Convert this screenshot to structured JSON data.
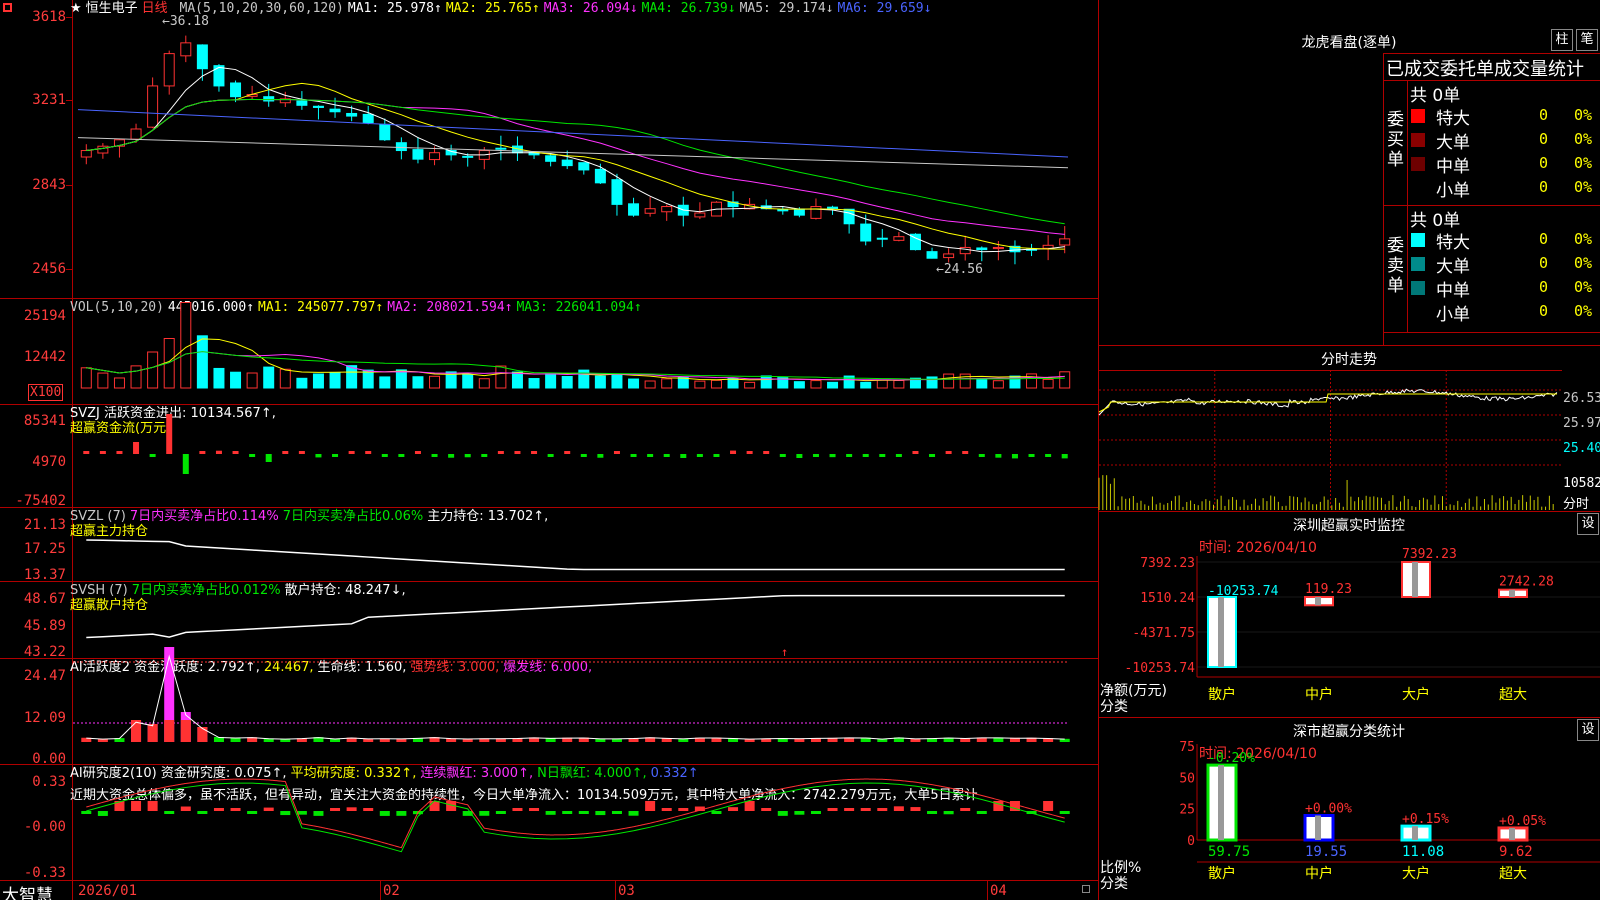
{
  "window": {
    "corner_icon": "menu-square-icon",
    "brand": "大智慧"
  },
  "stock": {
    "star": "★",
    "name": "恒生电子",
    "period": "日线"
  },
  "kline": {
    "y_labels": [
      "3618",
      "3231",
      "2843",
      "2456"
    ],
    "high_label": "36.18",
    "low_label": "24.56",
    "ma_info": [
      {
        "text": "MA(5,10,20,30,60,120)",
        "color": "#c8c8c8"
      },
      {
        "text": "MA1: 25.978↑",
        "color": "#ffffff"
      },
      {
        "text": "MA2: 25.765↑",
        "color": "#ffff00"
      },
      {
        "text": "MA3: 26.094↓",
        "color": "#ff32ff"
      },
      {
        "text": "MA4: 26.739↓",
        "color": "#00e600"
      },
      {
        "text": "MA5: 29.174↓",
        "color": "#c8c8c8"
      },
      {
        "text": "MA6: 29.659↓",
        "color": "#4a64ff"
      }
    ]
  },
  "vol": {
    "y_labels": [
      "25194",
      "12442",
      "X100"
    ],
    "info": [
      {
        "text": "VOL(5,10,20)",
        "color": "#c8c8c8"
      },
      {
        "text": "445016.000↑",
        "color": "#ffffff"
      },
      {
        "text": "MA1: 245077.797↑",
        "color": "#ffff00"
      },
      {
        "text": "MA2: 208021.594↑",
        "color": "#ff32ff"
      },
      {
        "text": "MA3: 226041.094↑",
        "color": "#00e600"
      }
    ]
  },
  "svzj": {
    "y_labels": [
      "85341",
      "4970",
      "-75402"
    ],
    "line1": "SVZJ  活跃资金进出: 10134.567↑,",
    "line2": "超赢资金流(万元)"
  },
  "svzl": {
    "y_labels": [
      "21.13",
      "17.25",
      "13.37"
    ],
    "info": [
      {
        "text": "SVZL (7)",
        "color": "#c8c8c8"
      },
      {
        "text": "7日内买卖净占比0.114%",
        "color": "#ff32ff"
      },
      {
        "text": "7日内买卖净占比0.06%",
        "color": "#00e600"
      },
      {
        "text": "主力持仓: 13.702↑,",
        "color": "#ffffff"
      }
    ],
    "line2": "超赢主力持仓"
  },
  "svsh": {
    "y_labels": [
      "48.67",
      "45.89",
      "43.22"
    ],
    "info": [
      {
        "text": "SVSH (7)",
        "color": "#c8c8c8"
      },
      {
        "text": "7日内买卖净占比0.012%",
        "color": "#00e600"
      },
      {
        "text": "散户持仓: 48.247↓,",
        "color": "#ffffff"
      }
    ],
    "line2": "超赢散户持仓"
  },
  "ai_active": {
    "y_labels": [
      "24.47",
      "12.09",
      "0.00"
    ],
    "info": [
      {
        "text": "AI活跃度2 资金活跃度: 2.792↑,",
        "color": "#ffffff"
      },
      {
        "text": "24.467,",
        "color": "#ffff00"
      },
      {
        "text": "生命线: 1.560,",
        "color": "#ffffff"
      },
      {
        "text": "强势线: 3.000,",
        "color": "#ff3232"
      },
      {
        "text": "爆发线: 6.000,",
        "color": "#ff32ff"
      }
    ]
  },
  "ai_research": {
    "y_labels": [
      "0.33",
      "-0.00",
      "-0.33"
    ],
    "info": [
      {
        "text": "AI研究度2(10) 资金研究度: 0.075↑,",
        "color": "#ffffff"
      },
      {
        "text": "平均研究度: 0.332↑,",
        "color": "#ffff00"
      },
      {
        "text": "连续飘红: 3.000↑,",
        "color": "#ff32ff"
      },
      {
        "text": "N日飘红: 4.000↑,",
        "color": "#00e600"
      },
      {
        "text": "0.332↑",
        "color": "#4a64ff"
      }
    ],
    "comment": "近期大资金总体偏多，虽不活跃，但有异动，宜关注大资金的持续性，今日大单净流入：10134.509万元，其中特大单净流入：2742.279万元，大单5日累计"
  },
  "x_labels": [
    "2026/01",
    "02",
    "03",
    "04"
  ],
  "longhu": {
    "title": "龙虎看盘(逐单)",
    "btn_bar": "柱",
    "btn_pen": "笔",
    "subtitle": "已成交委托单成交量统计",
    "buy_label": "委买单",
    "sell_label": "委卖单",
    "buy_total": "共 0单",
    "sell_total": "共 0单",
    "rows": [
      {
        "name": "特大",
        "value": "0",
        "pct": "0%"
      },
      {
        "name": "大单",
        "value": "0",
        "pct": "0%"
      },
      {
        "name": "中单",
        "value": "0",
        "pct": "0%"
      },
      {
        "name": "小单",
        "value": "0",
        "pct": "0%"
      }
    ],
    "buy_colors": [
      "#ff0000",
      "#8b0000",
      "#6e0000",
      "#000000"
    ],
    "sell_colors": [
      "#00ffff",
      "#008b8b",
      "#007878",
      "#000000"
    ]
  },
  "fenshi": {
    "title": "分时走势",
    "y_labels": [
      "26.53",
      "25.97",
      "25.40",
      "10582"
    ],
    "vol_unit": "分时"
  },
  "sz_monitor": {
    "title": "深圳超赢实时监控",
    "btn": "设",
    "time": "时间: 2026/04/10",
    "y_labels": [
      "7392.23",
      "1510.24",
      "-4371.75",
      "-10253.74"
    ],
    "axis_title": "净额(万元)",
    "axis_sub": "分类",
    "categories": [
      "散户",
      "中户",
      "大户",
      "超大"
    ],
    "values": [
      -10253.74,
      119.23,
      7392.23,
      2742.28
    ],
    "value_labels": [
      "-10253.74",
      "119.23",
      "7392.23",
      "2742.28"
    ]
  },
  "sz_class": {
    "title": "深市超赢分类统计",
    "btn": "设",
    "time": "时间: 2026/04/10",
    "y_labels": [
      "75",
      "50",
      "25",
      "0"
    ],
    "axis_title": "比例%",
    "axis_sub": "分类",
    "categories": [
      "散户",
      "中户",
      "大户",
      "超大"
    ],
    "values": [
      59.75,
      19.55,
      11.08,
      9.62
    ],
    "value_labels": [
      "59.75",
      "19.55",
      "11.08",
      "9.62"
    ],
    "change_labels": [
      "-0.20%",
      "+0.00%",
      "+0.15%",
      "+0.05%"
    ]
  }
}
